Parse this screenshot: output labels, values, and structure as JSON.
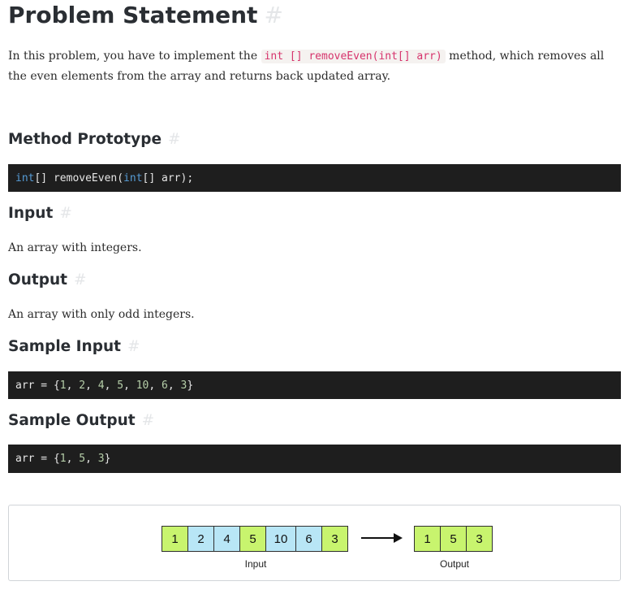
{
  "title": "Problem Statement",
  "hash": "#",
  "intro": {
    "before": "In this problem, you have to implement the ",
    "code": "int [] removeEven(int[] arr)",
    "after": " method, which removes all the even elements from the array and returns back updated array."
  },
  "sections": {
    "prototype": "Method Prototype",
    "input": "Input",
    "output": "Output",
    "sample_input": "Sample Input",
    "sample_output": "Sample Output"
  },
  "prototype_code": {
    "kw1": "int",
    "mid": "[] removeEven(",
    "kw2": "int",
    "end": "[] arr);"
  },
  "input_text": "An array with integers.",
  "output_text": "An array with only odd integers.",
  "sample_input_code": {
    "prefix": "arr = {",
    "values": [
      "1",
      "2",
      "4",
      "5",
      "10",
      "6",
      "3"
    ],
    "sep": ", ",
    "suffix": "}"
  },
  "sample_output_code": {
    "prefix": "arr = {",
    "values": [
      "1",
      "5",
      "3"
    ],
    "sep": ", ",
    "suffix": "}"
  },
  "figure": {
    "input_cells": [
      {
        "value": "1",
        "kind": "odd"
      },
      {
        "value": "2",
        "kind": "even"
      },
      {
        "value": "4",
        "kind": "even"
      },
      {
        "value": "5",
        "kind": "odd"
      },
      {
        "value": "10",
        "kind": "even"
      },
      {
        "value": "6",
        "kind": "even"
      },
      {
        "value": "3",
        "kind": "odd"
      }
    ],
    "output_cells": [
      {
        "value": "1",
        "kind": "odd"
      },
      {
        "value": "5",
        "kind": "odd"
      },
      {
        "value": "3",
        "kind": "odd"
      }
    ],
    "input_caption": "Input",
    "output_caption": "Output",
    "colors": {
      "odd": "#c8f46e",
      "even": "#b8e6f6",
      "code_bg": "#1e1e1e",
      "inline_code": "#d6336c"
    }
  }
}
